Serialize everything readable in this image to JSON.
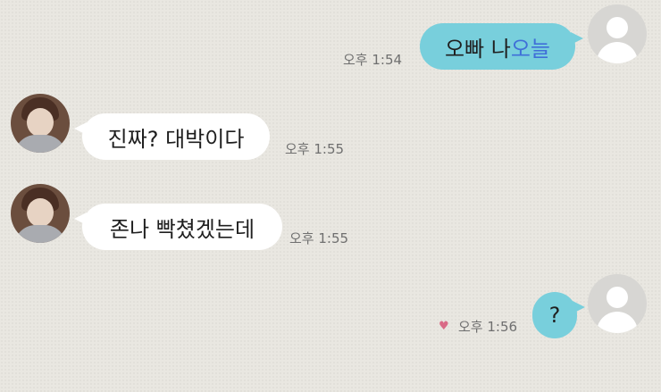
{
  "chat": {
    "messages": [
      {
        "sender": "me",
        "text_plain": "오빠 나 ",
        "text_highlight": "오늘",
        "time": "오후 1:54"
      },
      {
        "sender": "other",
        "text": "진짜? 대박이다",
        "time": "오후 1:55"
      },
      {
        "sender": "other",
        "text": "존나 빡쳤겠는데",
        "time": "오후 1:55"
      },
      {
        "sender": "me",
        "text": "?",
        "time": "오후 1:56",
        "reaction": "♥"
      }
    ]
  },
  "style": {
    "sent_bubble_color": "#78cfdc",
    "received_bubble_color": "#ffffff",
    "highlight_text_color": "#3f6fd8",
    "reaction_color": "#d96a86",
    "background_color": "#e9e7e1"
  }
}
